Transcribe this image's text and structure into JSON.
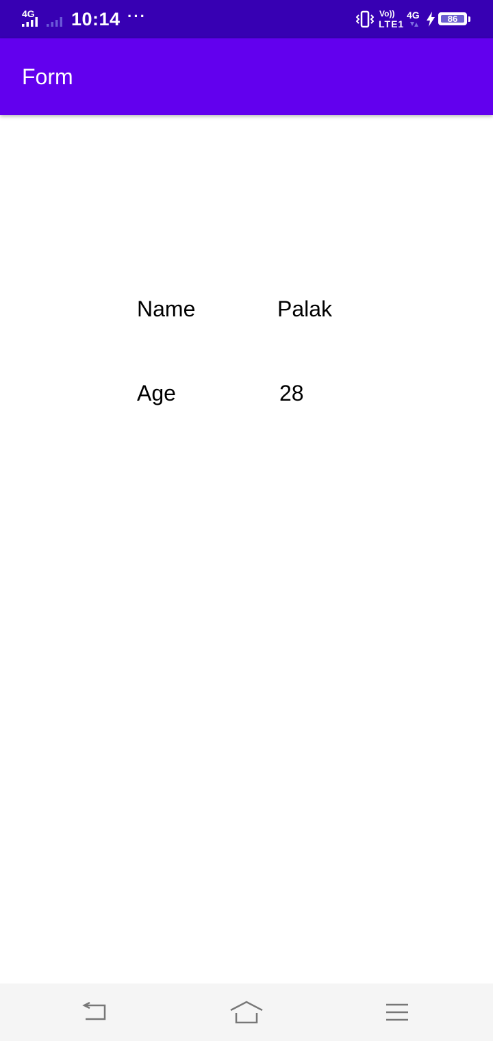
{
  "colors": {
    "status_bar": "#3700B3",
    "app_bar": "#6200EE",
    "nav_bar": "#F5F5F5",
    "nav_icon": "#777777",
    "battery_fill": "#6C5FD1"
  },
  "status_bar": {
    "network_sim1": "4G",
    "time": "10:14",
    "more": "···",
    "volte_top": "Vo))",
    "volte_bottom": "LTE1",
    "network_sim2": "4G",
    "battery_level": "86",
    "icons": [
      "signal-icon",
      "signal-weak-icon",
      "vibrate-icon",
      "charging-icon",
      "battery-icon"
    ]
  },
  "app_bar": {
    "title": "Form"
  },
  "form": {
    "rows": [
      {
        "label": "Name",
        "value": "Palak"
      },
      {
        "label": "Age",
        "value": "28"
      }
    ]
  },
  "nav_bar": {
    "icons": [
      "back-icon",
      "home-icon",
      "menu-icon"
    ]
  }
}
